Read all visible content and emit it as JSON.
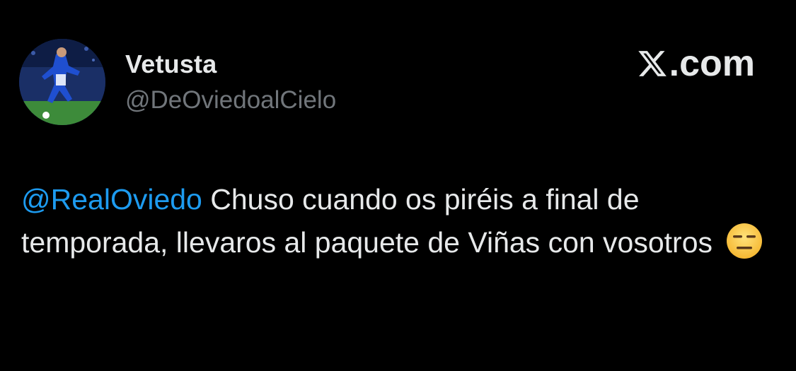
{
  "author": {
    "display_name": "Vetusta",
    "handle": "@DeOviedoalCielo",
    "avatar_icon": "soccer-player-avatar"
  },
  "brand": {
    "logo_icon": "x-logo-icon",
    "text": ".com"
  },
  "tweet": {
    "mention": "@RealOviedo",
    "text": " Chuso cuando os piréis a final de temporada, llevaros al paquete de Viñas con vosotros ",
    "emoji_icon": "expressionless-face-emoji"
  },
  "colors": {
    "background": "#000000",
    "text": "#e7e9ea",
    "secondary_text": "#71767b",
    "link": "#1d9bf0"
  }
}
